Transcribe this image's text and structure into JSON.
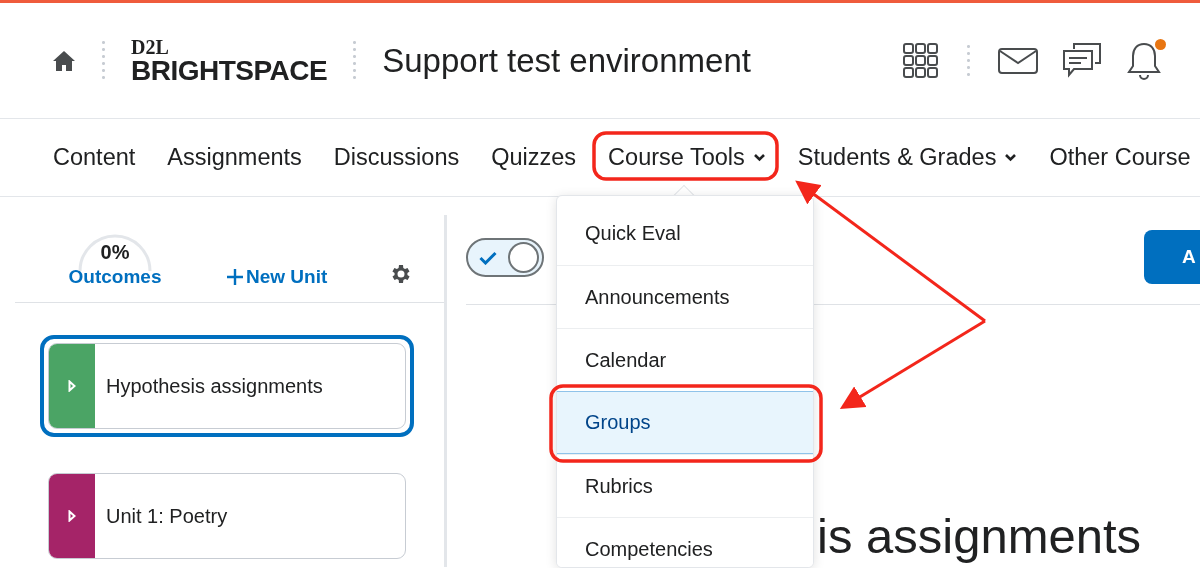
{
  "header": {
    "logo": {
      "top": "D2L",
      "bottom": "BRIGHTSPACE"
    },
    "title": "Support test environment",
    "notifications": true
  },
  "nav": [
    {
      "label": "Content",
      "kind": "link"
    },
    {
      "label": "Assignments",
      "kind": "link"
    },
    {
      "label": "Discussions",
      "kind": "link"
    },
    {
      "label": "Quizzes",
      "kind": "link"
    },
    {
      "label": "Course Tools",
      "kind": "menu"
    },
    {
      "label": "Students & Grades",
      "kind": "menu"
    },
    {
      "label": "Other Course",
      "kind": "link"
    }
  ],
  "menu": [
    {
      "label": "Quick Eval",
      "selected": false
    },
    {
      "label": "Announcements",
      "selected": false
    },
    {
      "label": "Calendar",
      "selected": false
    },
    {
      "label": "Groups",
      "selected": true
    },
    {
      "label": "Rubrics",
      "selected": false
    },
    {
      "label": "Competencies",
      "selected": false
    }
  ],
  "sidebar": {
    "outcomes": {
      "reading": "0%",
      "label": "Outcomes"
    },
    "new_unit": "New Unit",
    "units": [
      {
        "title": "Hypothesis assignments",
        "color": "#4ba465",
        "selected": true
      },
      {
        "title": "Unit 1: Poetry",
        "color": "#a52468",
        "selected": false
      }
    ]
  },
  "main": {
    "toggle": {
      "on": true
    },
    "button": "A",
    "heading": "is assignments"
  }
}
